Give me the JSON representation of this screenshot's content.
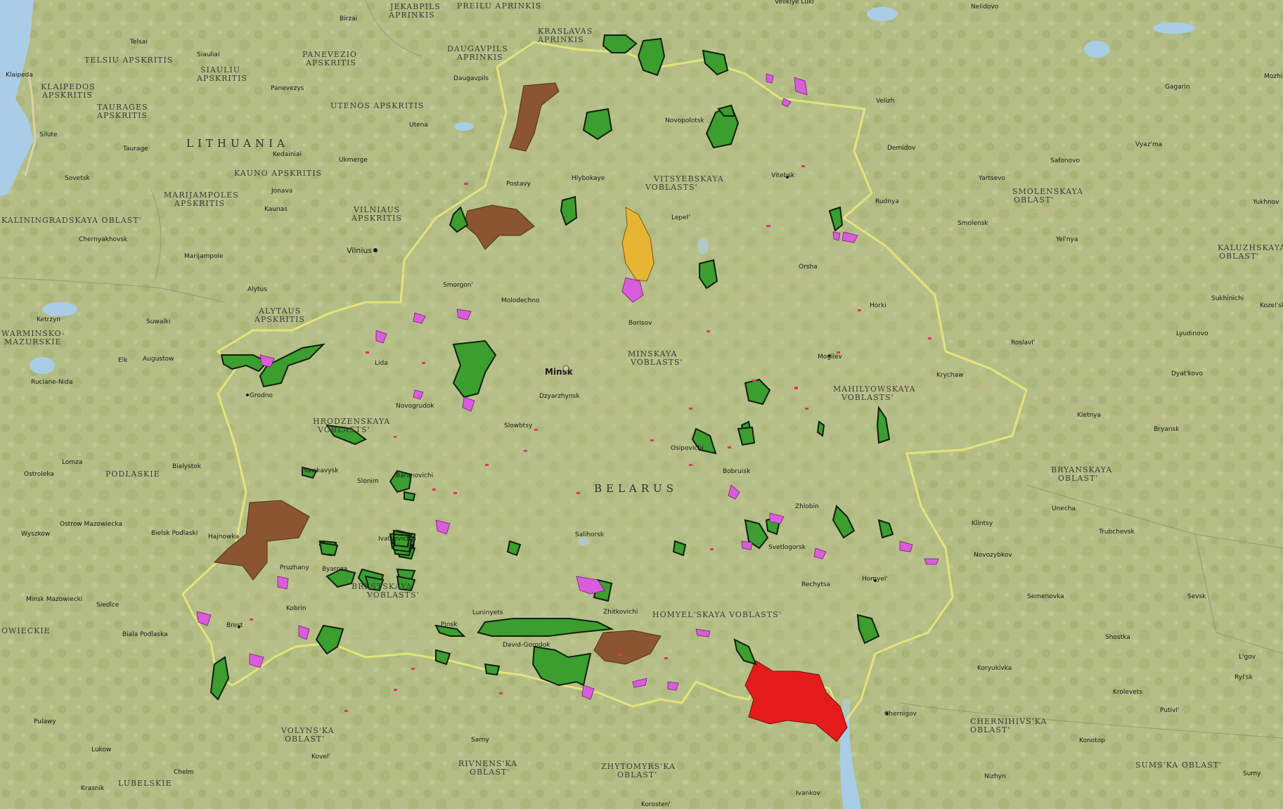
{
  "map": {
    "colors": {
      "land": "#b4bd86",
      "land_light": "#c3c996",
      "forest": "#9fae6f",
      "water": "#a9cde6",
      "belarus_border": "#e1e37a",
      "protected_green": "#3b9e2f",
      "protected_brown": "#8a5530",
      "protected_orange": "#e7b433",
      "protected_red": "#e51b1b",
      "protected_magenta": "#d95ddb",
      "protected_crimson": "#e0356e"
    },
    "countries": {
      "lithuania": "LITHUANIA",
      "belarus": "BELARUS"
    },
    "regions": {
      "vitsyebskaya": [
        "VITSYEBSKAYA",
        "VOBLASTS'"
      ],
      "minskaya": [
        "MINSKAYA",
        "VOBLASTS'"
      ],
      "mahilyowskaya": [
        "MAHILYOWSKAYA",
        "VOBLASTS'"
      ],
      "hrodzenskaya": [
        "HRODZENSKAYA",
        "VOBLASTS'"
      ],
      "brestskaya": [
        "BRESTSKAYA",
        "VOBLASTS'"
      ],
      "homyelskaya": [
        "HOMYEL'SKAYA VOBLASTS'"
      ],
      "smolenskaya": [
        "SMOLENSKAYA",
        "OBLAST'"
      ],
      "kaluzhskaya": [
        "KALUZHSKAYA",
        "OBLAST'"
      ],
      "bryanskaya": [
        "BRYANSKAYA",
        "OBLAST'"
      ],
      "chernihivska": [
        "CHERNIHIVS'KA",
        "OBLAST'"
      ],
      "sumska": [
        "SUMS'KA OBLAST'"
      ],
      "zhytomyrska": [
        "ZHYTOMYRS'KA",
        "OBLAST'"
      ],
      "rivnenska": [
        "RIVNENS'KA",
        "OBLAST'"
      ],
      "volynska": [
        "VOLYNS'KA",
        "OBLAST'"
      ],
      "podlaskie": [
        "PODLASKIE"
      ],
      "lubelskie": [
        "LUBELSKIE"
      ],
      "kaliningradskaya": [
        "KALININGRADSKAYA OBLAST'"
      ],
      "warminsko": [
        "WARMINSKO-",
        "MAZURSKIE"
      ],
      "mazowieckie": [
        "OWIECKIE"
      ],
      "telsiu": [
        "TELSIU APSKRITIS"
      ],
      "klaipedos": [
        "KLAIPEDOS",
        "APSKRITIS"
      ],
      "taurages": [
        "TAURAGES",
        "APSKRITIS"
      ],
      "siauliu": [
        "SIAULIU",
        "APSKRITIS"
      ],
      "panevezio": [
        "PANEVEZIO",
        "APSKRITIS"
      ],
      "utenos": [
        "UTENOS APSKRITIS"
      ],
      "kauno": [
        "KAUNO APSKRITIS"
      ],
      "marijampoles": [
        "MARIJAMPOLES",
        "APSKRITIS"
      ],
      "vilniaus": [
        "VILNIAUS",
        "APSKRITIS"
      ],
      "alytaus": [
        "ALYTAUS",
        "APSKRITIS"
      ],
      "jekabpils": [
        "JEKABPILS",
        "APRINKIS"
      ],
      "preilu": [
        "PREILU APRINKIS"
      ],
      "kraslavas": [
        "KRASLAVAS",
        "APRINKIS"
      ],
      "daugavpils": [
        "DAUGAVPILS",
        "APRINKIS"
      ]
    },
    "cities": {
      "minsk": "Minsk",
      "vilnius": "Vilnius",
      "klaipeda": "Klaipeda",
      "telsai": "Telsai",
      "siauliai": "Siauliai",
      "birzai": "Birzai",
      "panevezys": "Panevezys",
      "kedainiai": "Kedainiai",
      "ukmerge": "Ukmerge",
      "utena": "Utena",
      "silute": "Silute",
      "taurage": "Taurage",
      "sovetsk": "Sovetsk",
      "chernyakhovsk": "Chernyakhovsk",
      "jonava": "Jonava",
      "kaunas": "Kaunas",
      "marijampole": "Marijampole",
      "alytus": "Alytus",
      "daugavpils": "Daugavpils",
      "postavy": "Postavy",
      "hlybokaye": "Hlybokaye",
      "navapolatsk": "Novopolotsk",
      "vitebsk": "Vitebsk",
      "lepel": "Lepel'",
      "orsha": "Orsha",
      "smorgon": "Smorgon'",
      "molodechno": "Molodechno",
      "lida": "Lida",
      "grodno": "Grodno",
      "novogrudok": "Novogrudok",
      "dzyarzhynsk": "Dzyarzhynsk",
      "barysaw": "Borisov",
      "slutsk": "Slowbtsy",
      "mogilev": "Mogilev",
      "horki": "Horki",
      "krychaw": "Krychaw",
      "babruysk": "Bobruisk",
      "osipovichi": "Osipovichi",
      "zhlobin": "Zhlobin",
      "svetlogorsk": "Svetlogorsk",
      "rechytsa": "Rechytsa",
      "homyel": "Homyel'",
      "mazyr": "Zhitkovichi",
      "luninets": "Luninyets",
      "pinsk": "Pinsk",
      "david": "David-Gorodok",
      "salihorsk": "Salihorsk",
      "slonim": "Slonim",
      "baranavichy": "Baranovichi",
      "ivatsevichy": "Ivatsevichy",
      "pruzhany": "Pruzhany",
      "kobryn": "Kobrin",
      "brest": "Brest",
      "byaroza": "Byaroza",
      "vawkavysk": "Vawkavysk",
      "hajnowka": "Hajnowka",
      "bielsk": "Bielsk Podlaski",
      "bialystok": "Bialystok",
      "lomza": "Lomza",
      "ostroleka": "Ostroleka",
      "ostrow": "Ostrow Mazowiecka",
      "wyszkow": "Wyszkow",
      "minsk_maz": "Minsk Mazowiecki",
      "siedlce": "Siedlce",
      "biala": "Biala Podlaska",
      "elk": "Elk",
      "augustow": "Augustow",
      "suwalki": "Suwalki",
      "ketrzyn": "Ketrzyn",
      "ruciane": "Ruciane-Nida",
      "chelm": "Chelm",
      "lukow": "Lukow",
      "krasnik": "Krasnik",
      "pulawy": "Pulawy",
      "kovel": "Kovel'",
      "sarny": "Sarny",
      "korosten": "Korosten'",
      "ivankov": "Ivankov",
      "chernigov": "Chernigov",
      "nizhyn": "Nizhyn",
      "konotop": "Konotop",
      "koryukivka": "Koryukivka",
      "krolevets": "Krolevets",
      "shostka": "Shostka",
      "putivl": "Putivl'",
      "sumy": "Sumy",
      "novozybkov": "Novozybkov",
      "klintsy": "Klintsy",
      "unecha": "Unecha",
      "trubchevsk": "Trubchevsk",
      "semenovka": "Semenovka",
      "sevsk": "Sevsk",
      "lgov": "L'gov",
      "rylsk": "Ryl'sk",
      "bryansk": "Bryansk",
      "klyetnya": "Kletnya",
      "dyatkovo": "Dyat'kovo",
      "lyudinovo": "Lyudinovo",
      "sukhinichi": "Sukhinichi",
      "kozelsk": "Kozel'sk",
      "roslavl": "Roslavl'",
      "yelnya": "Yel'nya",
      "smolensk": "Smolensk",
      "rudnya": "Rudnya",
      "demidov": "Demidov",
      "velizh": "Velizh",
      "yartsevo": "Yartsevo",
      "safonovo": "Safonovo",
      "vyazma": "Vyaz'ma",
      "gagarin": "Gagarin",
      "yukhnov": "Yukhnov",
      "nelidovo": "Nelidovo",
      "velikiye_luki": "Velikiye Luki",
      "mozh": "Mozhi"
    }
  }
}
